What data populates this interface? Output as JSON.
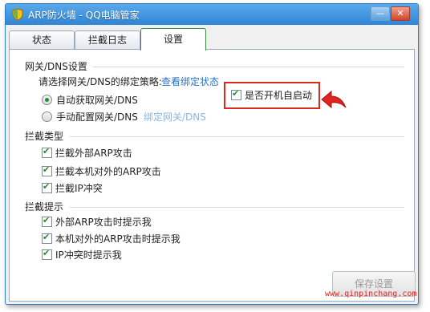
{
  "window": {
    "title": "ARP防火墙 - QQ电脑管家",
    "minimize": "—",
    "close": "✕"
  },
  "tabs": [
    {
      "label": "状态"
    },
    {
      "label": "拦截日志"
    },
    {
      "label": "设置"
    }
  ],
  "gateway": {
    "heading": "网关/DNS设置",
    "prompt": "请选择网关/DNS的绑定策略:",
    "view_link": "查看绑定状态",
    "option_auto": "自动获取网关/DNS",
    "option_manual": "手动配置网关/DNS",
    "bind_link": "绑定网关/DNS",
    "autostart": "是否开机自启动"
  },
  "intercept": {
    "heading": "拦截类型",
    "items": [
      "拦截外部ARP攻击",
      "拦截本机对外的ARP攻击",
      "拦截IP冲突"
    ]
  },
  "notify": {
    "heading": "拦截提示",
    "items": [
      "外部ARP攻击时提示我",
      "本机对外的ARP攻击时提示我",
      "IP冲突时提示我"
    ]
  },
  "save_button": "保存设置",
  "watermark": "www.qinpinchang.com",
  "colors": {
    "accent": "#2f85d6",
    "link": "#2a74c2",
    "highlight": "#d42c20"
  }
}
